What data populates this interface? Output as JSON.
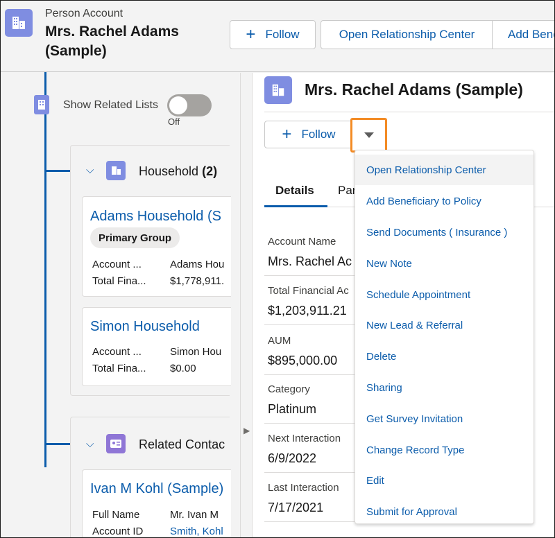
{
  "header": {
    "object_type": "Person Account",
    "title": "Mrs. Rachel Adams (Sample)",
    "follow_label": "Follow",
    "open_relationship_center_label": "Open Relationship Center",
    "add_beneficiary_label": "Add Bene"
  },
  "left_panel": {
    "show_related_lists_label": "Show Related Lists",
    "toggle_state": "Off",
    "household": {
      "title": "Household",
      "count": "(2)",
      "records": [
        {
          "name": "Adams Household (S",
          "badge": "Primary Group",
          "fields": [
            {
              "label": "Account ...",
              "value": "Adams Hou"
            },
            {
              "label": "Total Fina...",
              "value": "$1,778,911."
            }
          ]
        },
        {
          "name": "Simon Household",
          "fields": [
            {
              "label": "Account ...",
              "value": "Simon Hou"
            },
            {
              "label": "Total Fina...",
              "value": "$0.00"
            }
          ]
        }
      ]
    },
    "related_contacts": {
      "title": "Related Contac",
      "records": [
        {
          "name": "Ivan M Kohl (Sample)",
          "fields": [
            {
              "label": "Full Name",
              "value": "Mr. Ivan M"
            },
            {
              "label": "Account ID",
              "value": "Smith, Kohl"
            }
          ]
        }
      ]
    }
  },
  "right_panel": {
    "title": "Mrs. Rachel Adams (Sample)",
    "follow_label": "Follow",
    "tabs": [
      "Details",
      "Par"
    ],
    "fields": [
      {
        "label": "Account Name",
        "value": "Mrs. Rachel Ac"
      },
      {
        "label": "Total Financial Ac",
        "value": "$1,203,911.21"
      },
      {
        "label": "AUM",
        "value": "$895,000.00"
      },
      {
        "label": "Category",
        "value": "Platinum"
      },
      {
        "label": "Next Interaction",
        "value": "6/9/2022"
      },
      {
        "label": "Last Interaction",
        "value": "7/17/2021"
      }
    ]
  },
  "menu": {
    "items": [
      "Open Relationship Center",
      "Add Beneficiary to Policy",
      "Send Documents ( Insurance )",
      "New Note",
      "Schedule Appointment",
      "New Lead & Referral",
      "Delete",
      "Sharing",
      "Get Survey Invitation",
      "Change Record Type",
      "Edit",
      "Submit for Approval"
    ]
  },
  "icons": {
    "account": "building-icon",
    "contact": "contact-card-icon",
    "plus": "plus-icon",
    "chevron": "chevron-down-icon",
    "dropdown": "triangle-down-icon"
  },
  "colors": {
    "brand_blue": "#0b5cab",
    "account_icon": "#7f8de1",
    "contact_icon": "#8f76d6",
    "highlight_border": "#f38b25"
  }
}
